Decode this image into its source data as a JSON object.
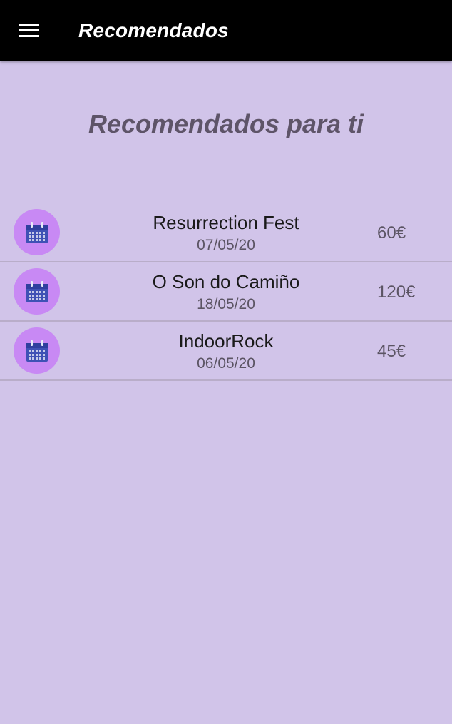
{
  "appbar": {
    "title": "Recomendados",
    "menu_icon": "hamburger-menu-icon"
  },
  "heading": "Recomendados para ti",
  "colors": {
    "appbar_bg": "#000000",
    "page_bg": "#d1c4e9",
    "icon_circle": "#c889f4",
    "calendar_icon": "#3f51b5"
  },
  "events": [
    {
      "name": "Resurrection Fest",
      "date": "07/05/20",
      "price": "60€",
      "icon": "calendar-icon"
    },
    {
      "name": "O Son do Camiño",
      "date": "18/05/20",
      "price": "120€",
      "icon": "calendar-icon"
    },
    {
      "name": "IndoorRock",
      "date": "06/05/20",
      "price": "45€",
      "icon": "calendar-icon"
    }
  ]
}
